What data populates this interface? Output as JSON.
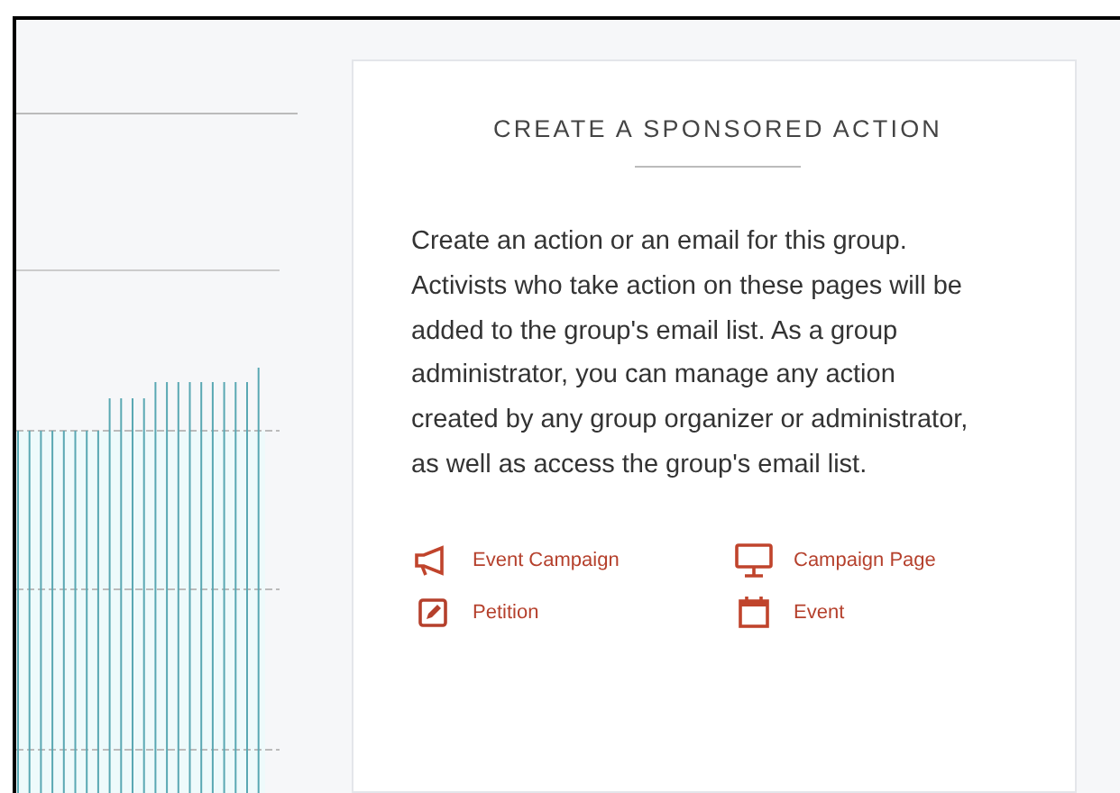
{
  "chart": {
    "kind": "bars"
  },
  "card": {
    "title": "CREATE A SPONSORED ACTION",
    "description": "Create an action or an email for this group. Activists who take action on these pages will be added to the group's email list. As a group administrator, you can manage any action created by any group organizer or administrator, as well as access the group's email list.",
    "actions": [
      {
        "label": "Event Campaign",
        "kind": "megaphone"
      },
      {
        "label": "Campaign Page",
        "kind": "monitor"
      },
      {
        "label": "Petition",
        "kind": "pencil"
      },
      {
        "label": "Event",
        "kind": "calendar"
      }
    ]
  }
}
